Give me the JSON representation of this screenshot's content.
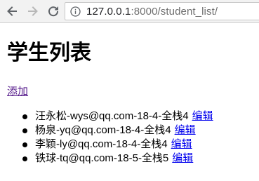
{
  "browser": {
    "url_host": "127.0.0.1",
    "url_rest": ":8000/student_list/"
  },
  "page": {
    "title": "学生列表",
    "add_link": "添加",
    "edit_label": "编辑",
    "students": [
      "汪永松-wys@qq.com-18-4-全栈4",
      "杨泉-yq@qq.com-18-4-全栈4",
      "李颖-ly@qq.com-18-4-全栈4",
      "铁球-tq@qq.com-18-5-全栈5"
    ]
  }
}
